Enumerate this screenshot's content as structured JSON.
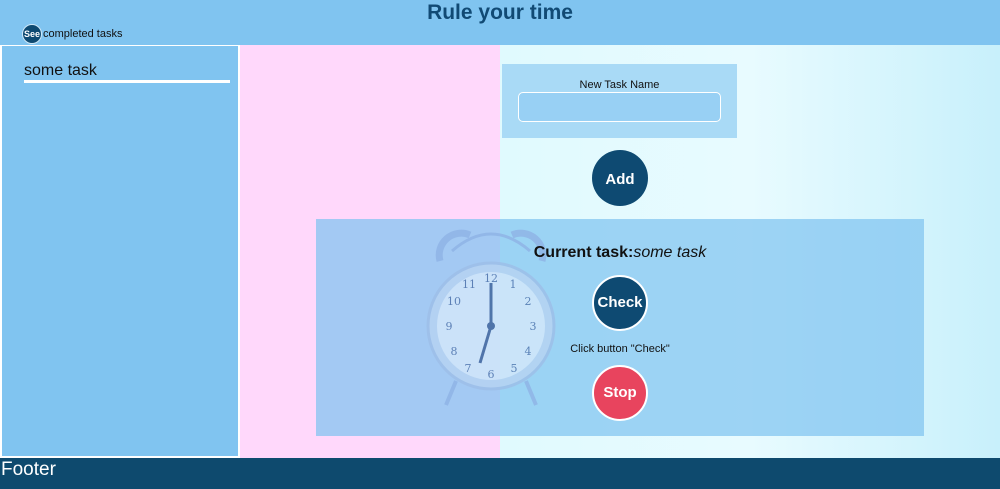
{
  "header": {
    "title": "Rule your time",
    "see_button_label": "See",
    "see_text": "completed tasks"
  },
  "sidebar": {
    "items": [
      {
        "label": "some task"
      }
    ]
  },
  "new_task_form": {
    "label": "New Task Name",
    "input_value": "",
    "add_button_label": "Add"
  },
  "current_task": {
    "label": "Current task:",
    "name": "some task",
    "check_button_label": "Check",
    "hint": "Click button \"Check\"",
    "stop_button_label": "Stop"
  },
  "footer": {
    "text": "Footer"
  },
  "colors": {
    "header_bg": "#80c4f0",
    "title_color": "#114a74",
    "primary_button": "#0e4a72",
    "stop_button": "#e8445e",
    "footer_bg": "#0e4a6e"
  },
  "icons": {
    "background_illustration": "alarm-clock-icon"
  }
}
